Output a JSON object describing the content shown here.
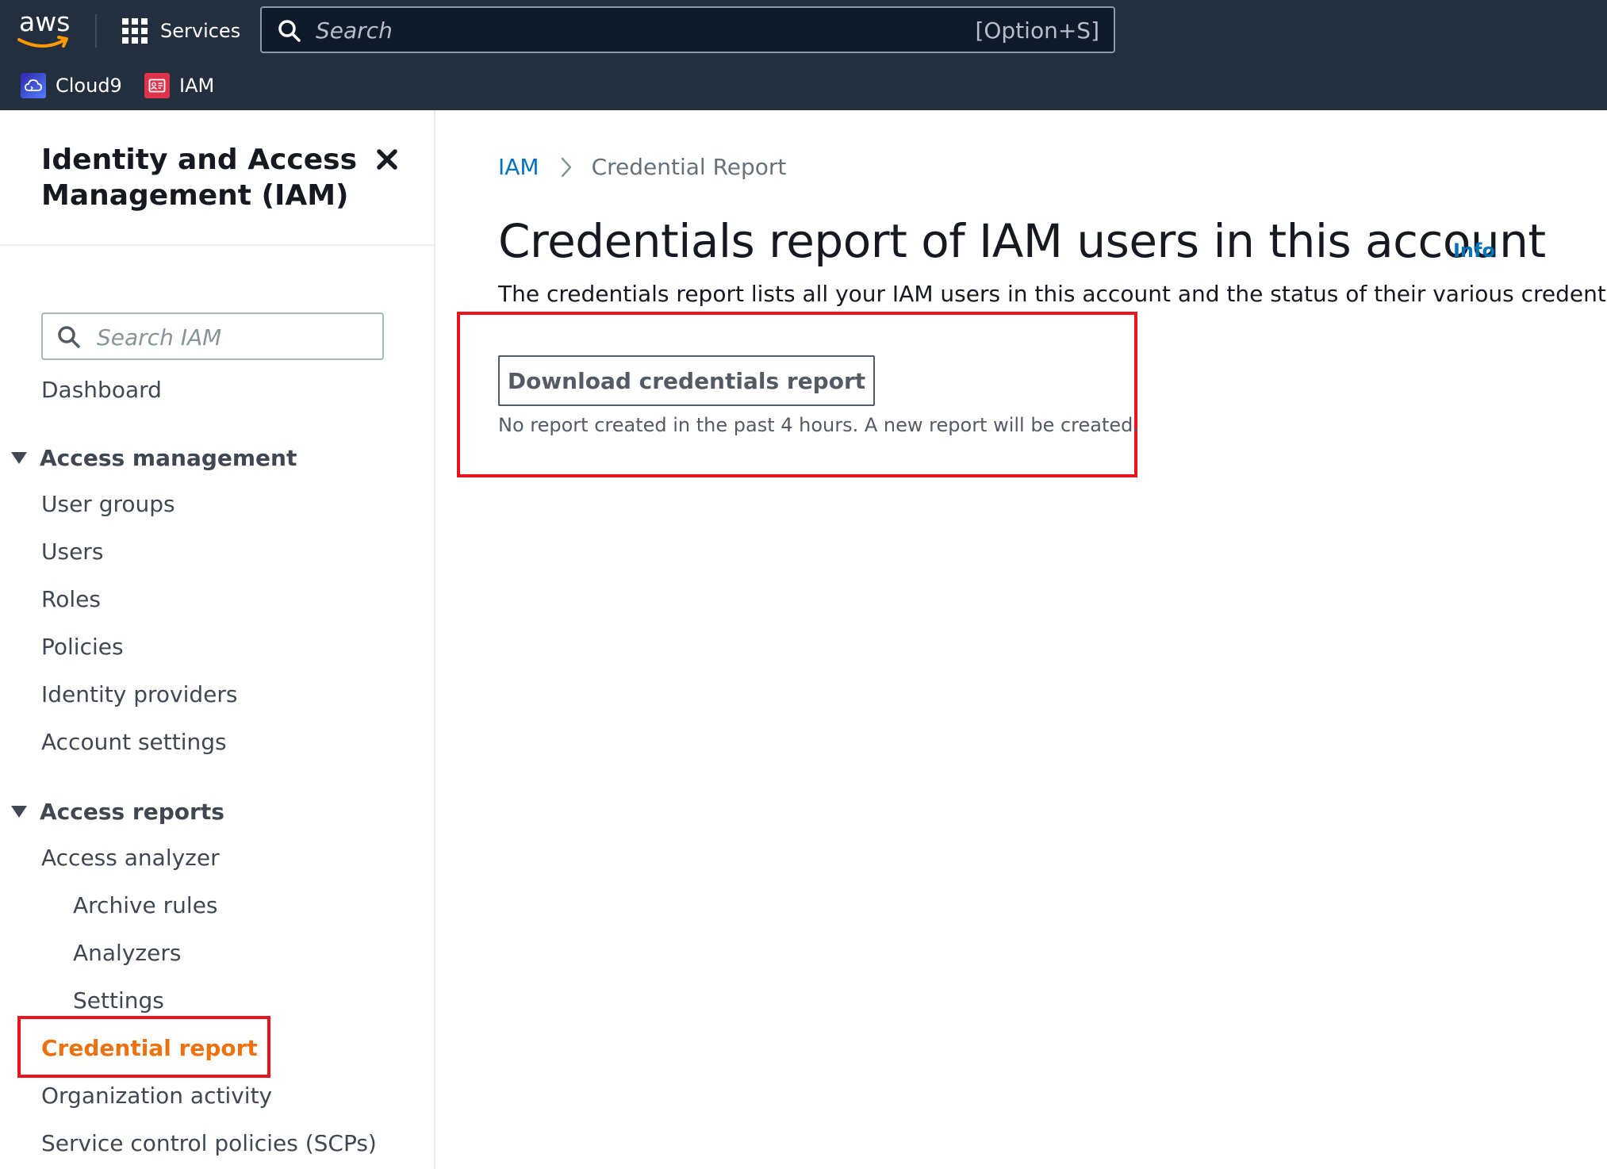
{
  "topnav": {
    "logo_text": "aws",
    "services_label": "Services",
    "search_placeholder": "Search",
    "search_shortcut": "[Option+S]",
    "favorites": [
      {
        "label": "Cloud9",
        "icon": "cloud9-icon",
        "color": "#4c4cff"
      },
      {
        "label": "IAM",
        "icon": "iam-icon",
        "color": "#dd344c"
      }
    ],
    "background": "#232f3e"
  },
  "sidebar": {
    "title": "Identity and Access Management (IAM)",
    "search_placeholder": "Search IAM",
    "dashboard": "Dashboard",
    "section_access_management": "Access management",
    "access_management_items": [
      "User groups",
      "Users",
      "Roles",
      "Policies",
      "Identity providers",
      "Account settings"
    ],
    "section_access_reports": "Access reports",
    "access_analyzer": "Access analyzer",
    "analyzer_items": [
      "Archive rules",
      "Analyzers",
      "Settings"
    ],
    "credential_report": "Credential report",
    "organization_activity": "Organization activity",
    "scps": "Service control policies (SCPs)",
    "active_color": "#ec7211"
  },
  "main": {
    "breadcrumb_root": "IAM",
    "breadcrumb_current": "Credential Report",
    "title": "Credentials report of IAM users in this account",
    "info_label": "Info",
    "description": "The credentials report lists all your IAM users in this account and the status of their various credentials. After a",
    "download_button": "Download credentials report",
    "hint": "No report created in the past 4 hours. A new report will be created.",
    "link_color": "#0073bb",
    "highlight_color": "#e8131d"
  }
}
